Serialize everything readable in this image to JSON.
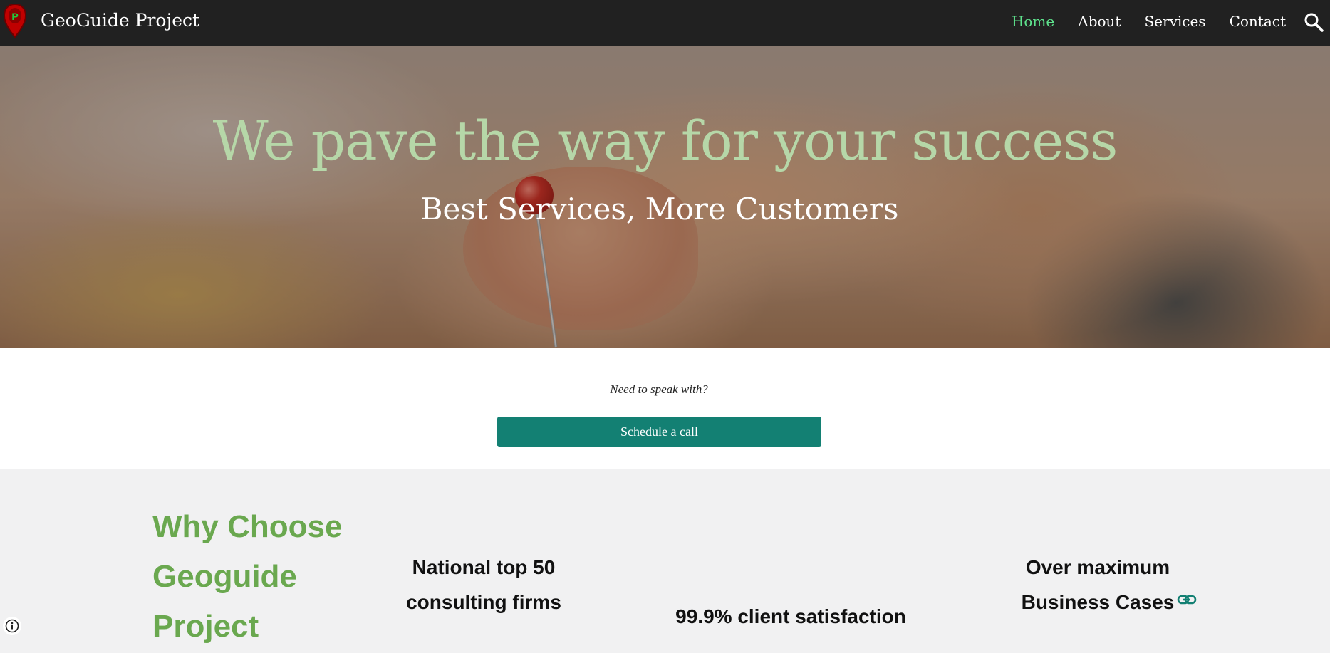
{
  "header": {
    "site_title": "GeoGuide Project",
    "logo_letter": "P",
    "nav": [
      {
        "label": "Home",
        "active": true
      },
      {
        "label": "About",
        "active": false
      },
      {
        "label": "Services",
        "active": false
      },
      {
        "label": "Contact",
        "active": false
      }
    ],
    "icons": {
      "search": "search-icon",
      "logo": "map-pin-logo"
    }
  },
  "hero": {
    "title": "We pave the way for your success",
    "subtitle": "Best Services, More Customers"
  },
  "cta": {
    "prompt": "Need to speak with?",
    "button_label": "Schedule a call"
  },
  "why": {
    "heading": "Why Choose Geoguide Project",
    "features": [
      "National top 50 consulting firms",
      "99.9% client satisfaction",
      "Over maximum Business Cases"
    ],
    "link_icon": "link-icon"
  },
  "footer": {
    "info_icon": "info-icon"
  },
  "colors": {
    "nav_bg": "#212121",
    "nav_active": "#5ee38d",
    "hero_title": "#b6d7a8",
    "cta_button": "#138073",
    "heading_green": "#6aa84f",
    "section_bg": "#f1f1f2"
  }
}
